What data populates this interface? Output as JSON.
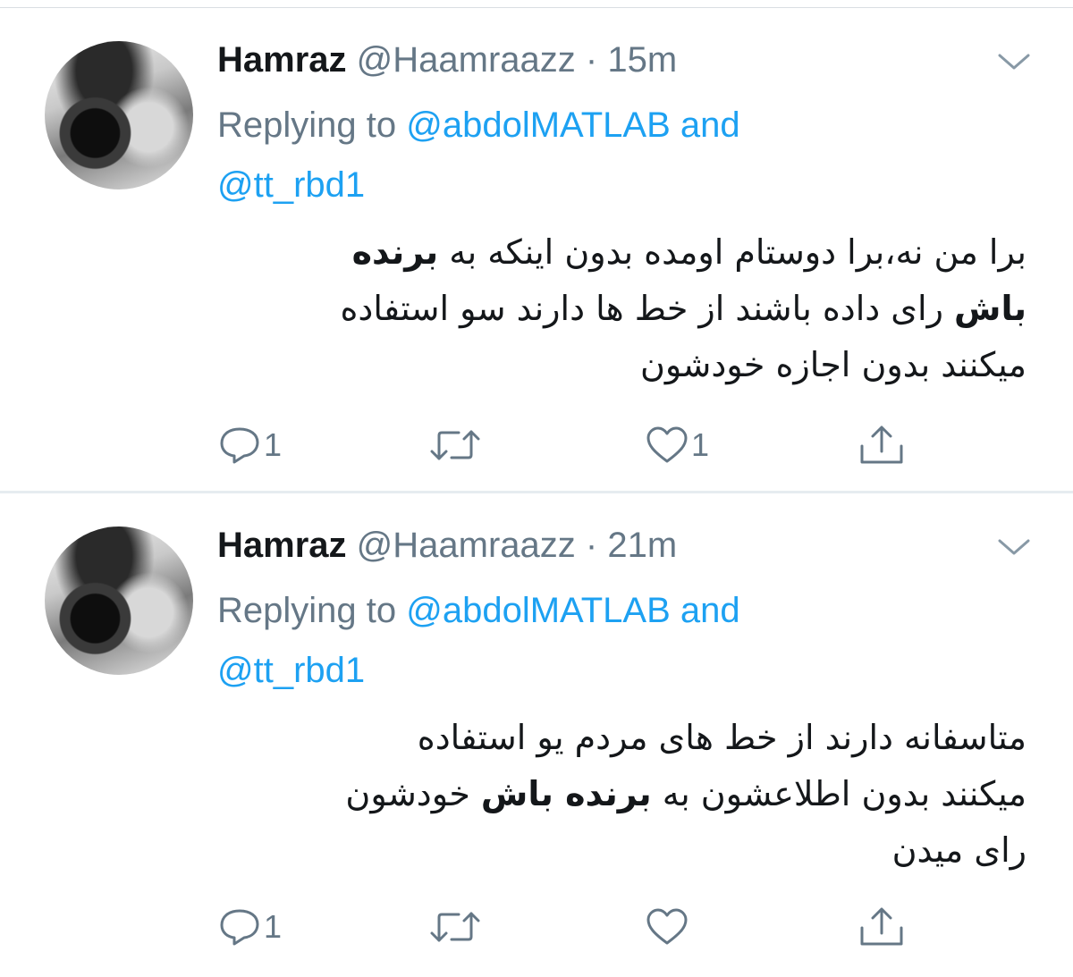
{
  "tweets": [
    {
      "name": "Hamraz",
      "handle": "@Haamraazz",
      "dot": "·",
      "time": "15m",
      "replying_prefix": "Replying to ",
      "mention_1": "@abdolMATLAB",
      "and_word": " and",
      "mention_2": "@tt_rbd1",
      "body_line_1a": "برا من نه،برا دوستام اومده بدون اینکه به ",
      "body_line_1b": "برنده",
      "body_line_2a": "باش",
      "body_line_2b": " رای داده باشند از خط ها دارند سو استفاده",
      "body_line_3": "میکنند بدون اجازه خودشون",
      "reply_count": "1",
      "retweet_count": "",
      "like_count": "1"
    },
    {
      "name": "Hamraz",
      "handle": "@Haamraazz",
      "dot": "·",
      "time": "21m",
      "replying_prefix": "Replying to ",
      "mention_1": "@abdolMATLAB",
      "and_word": " and",
      "mention_2": "@tt_rbd1",
      "body_line_1": "متاسفانه دارند از خط های مردم یو استفاده",
      "body_line_2a": "میکنند بدون اطلاعشون به ",
      "body_line_2b": "برنده باش",
      "body_line_2c": " خودشون",
      "body_line_3": "رای میدن",
      "reply_count": "1",
      "retweet_count": "",
      "like_count": ""
    }
  ],
  "icons": {
    "reply": "reply-icon",
    "retweet": "retweet-icon",
    "like": "heart-icon",
    "share": "share-icon",
    "menu": "chevron-down-icon"
  },
  "colors": {
    "link": "#1da1f2",
    "secondary": "#657786",
    "text": "#14171a"
  }
}
